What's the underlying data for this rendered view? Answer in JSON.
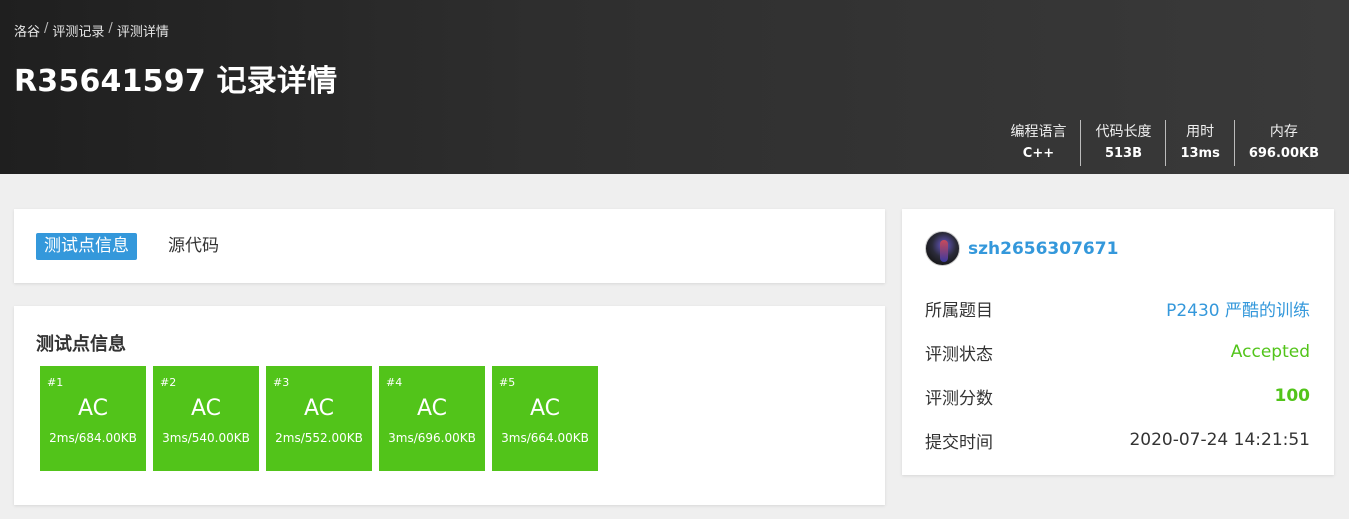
{
  "breadcrumb": [
    "洛谷",
    "评测记录",
    "评测详情"
  ],
  "breadcrumb_sep": "/",
  "title": "R35641597 记录详情",
  "stats": [
    {
      "label": "编程语言",
      "value": "C++"
    },
    {
      "label": "代码长度",
      "value": "513B"
    },
    {
      "label": "用时",
      "value": "13ms"
    },
    {
      "label": "内存",
      "value": "696.00KB"
    }
  ],
  "tabs": [
    {
      "label": "测试点信息",
      "active": true
    },
    {
      "label": "源代码",
      "active": false
    }
  ],
  "cases_title": "测试点信息",
  "cases": [
    {
      "id": "#1",
      "status": "AC",
      "info": "2ms/684.00KB"
    },
    {
      "id": "#2",
      "status": "AC",
      "info": "3ms/540.00KB"
    },
    {
      "id": "#3",
      "status": "AC",
      "info": "2ms/552.00KB"
    },
    {
      "id": "#4",
      "status": "AC",
      "info": "3ms/696.00KB"
    },
    {
      "id": "#5",
      "status": "AC",
      "info": "3ms/664.00KB"
    }
  ],
  "user": {
    "name": "szh2656307671"
  },
  "details": [
    {
      "label": "所属题目",
      "value": "P2430 严酷的训练"
    },
    {
      "label": "评测状态",
      "value": "Accepted"
    },
    {
      "label": "评测分数",
      "value": "100"
    },
    {
      "label": "提交时间",
      "value": "2020-07-24 14:21:51"
    }
  ],
  "colors": {
    "accent": "#3498db",
    "ac": "#52c41a",
    "header_bg": "#2e2e2e"
  }
}
